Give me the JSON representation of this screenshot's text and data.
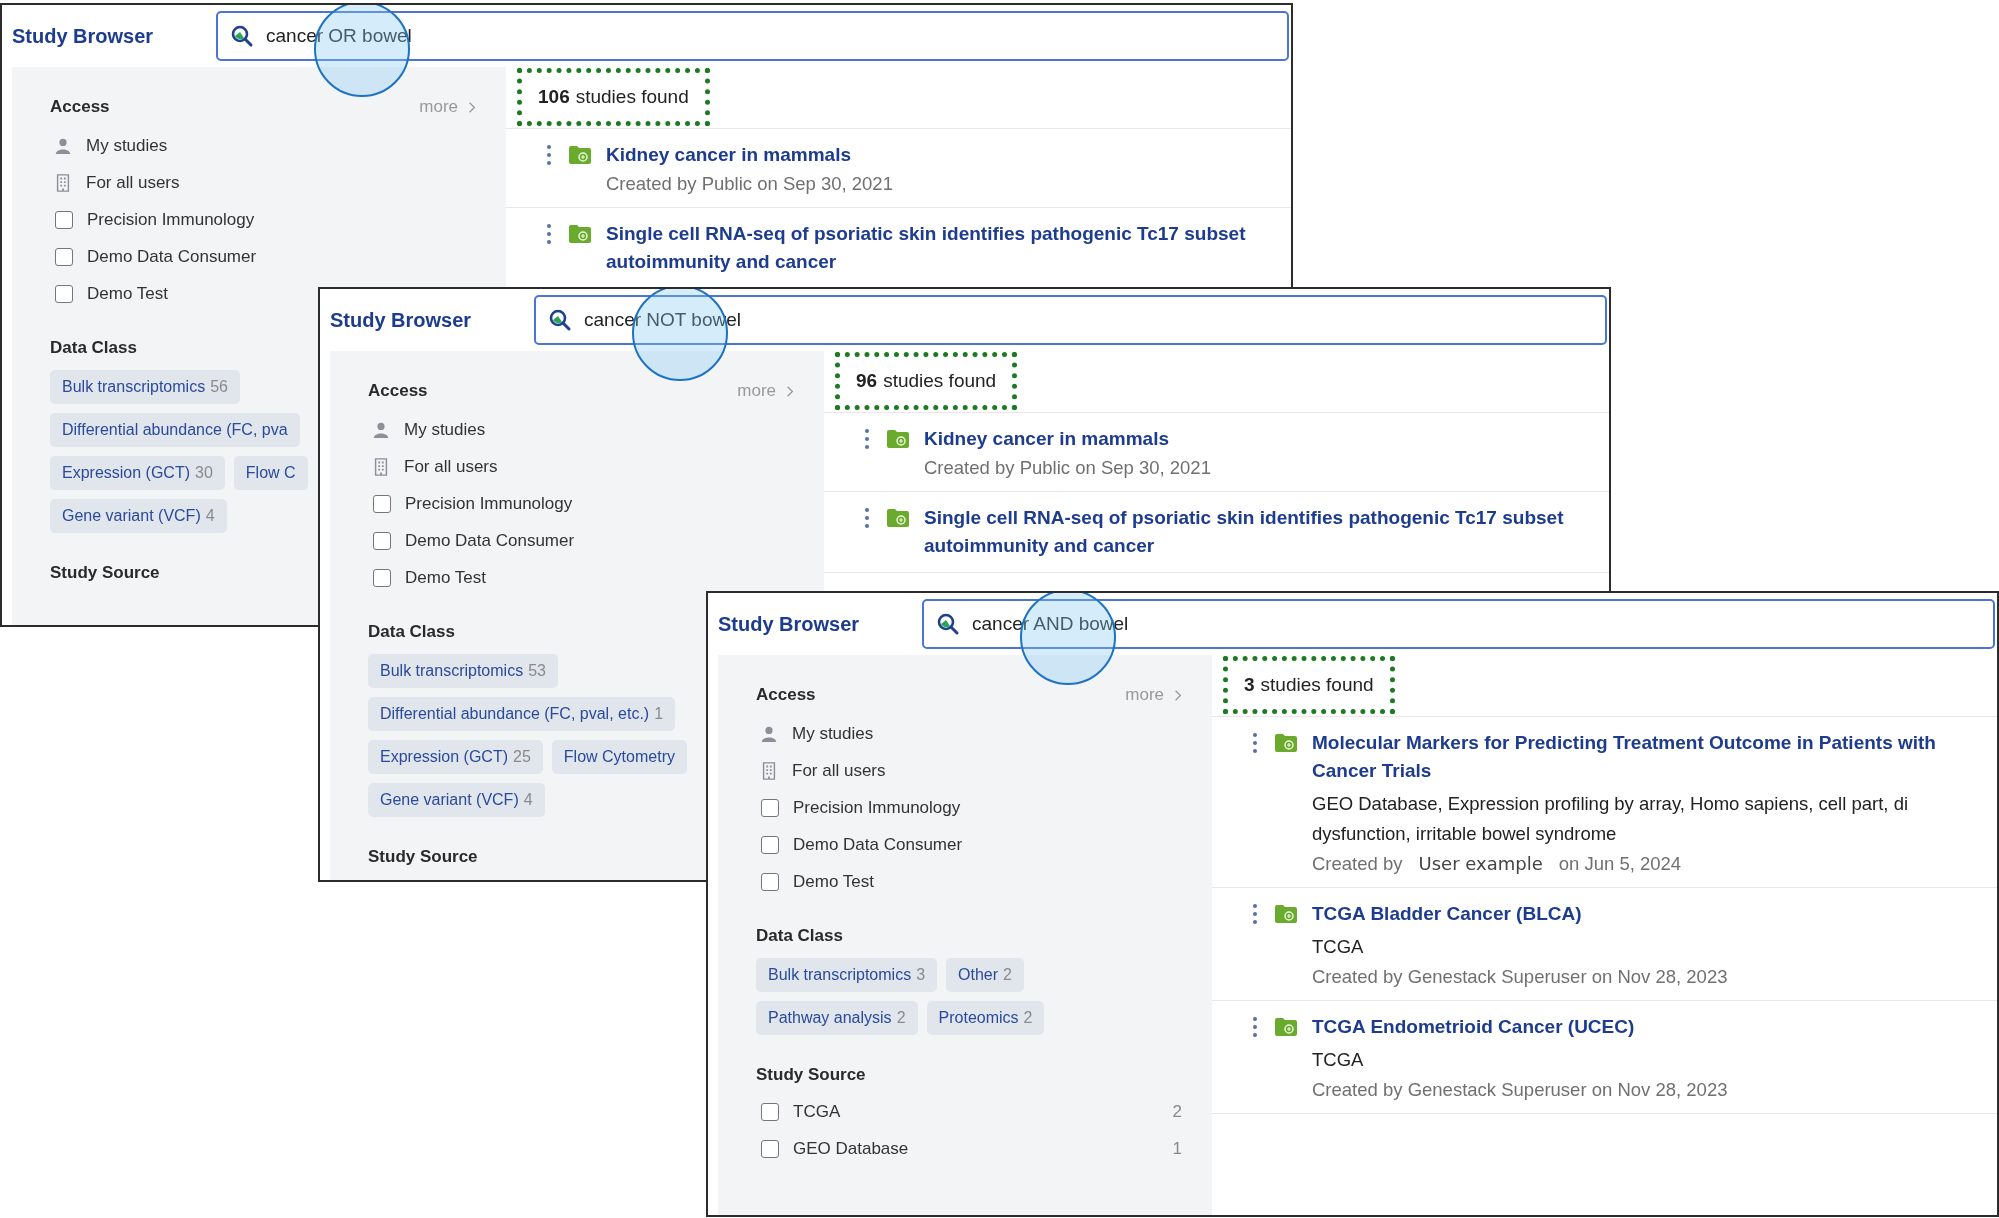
{
  "windows": [
    {
      "brand": "Study Browser",
      "search": {
        "value": "cancer OR bowel"
      },
      "sidebar": {
        "access": {
          "heading": "Access",
          "more": "more",
          "items": [
            {
              "kind": "person",
              "label": "My studies"
            },
            {
              "kind": "building",
              "label": "For all users"
            },
            {
              "kind": "checkbox",
              "label": "Precision Immunology",
              "checked": false
            },
            {
              "kind": "checkbox",
              "label": "Demo Data Consumer",
              "checked": false
            },
            {
              "kind": "checkbox",
              "label": "Demo Test",
              "checked": false
            }
          ]
        },
        "data_class": {
          "heading": "Data Class",
          "chip_rows": [
            [
              {
                "label": "Bulk transcriptomics",
                "count": "56"
              }
            ],
            [
              {
                "label": "Differential abundance (FC, pva"
              }
            ],
            [
              {
                "label": "Expression (GCT)",
                "count": "30"
              },
              {
                "label": "Flow C"
              }
            ],
            [
              {
                "label": "Gene variant (VCF)",
                "count": "4"
              }
            ]
          ]
        },
        "study_source": {
          "heading": "Study Source"
        }
      },
      "results": {
        "count": "106",
        "count_label": "studies found",
        "studies": [
          {
            "title_lines": [
              "Kidney cancer in mammals"
            ],
            "meta_parts": [
              {
                "text": "Created by Public on Sep 30, 2021",
                "kind": "plain"
              }
            ]
          },
          {
            "title_lines": [
              "Single cell RNA-seq of psoriatic skin identifies pathogenic Tc17 subset",
              "autoimmunity and cancer"
            ]
          }
        ]
      }
    },
    {
      "brand": "Study Browser",
      "search": {
        "value": "cancer NOT bowel"
      },
      "sidebar": {
        "access": {
          "heading": "Access",
          "more": "more",
          "items": [
            {
              "kind": "person",
              "label": "My studies"
            },
            {
              "kind": "building",
              "label": "For all users"
            },
            {
              "kind": "checkbox",
              "label": "Precision Immunology",
              "checked": false
            },
            {
              "kind": "checkbox",
              "label": "Demo Data Consumer",
              "checked": false
            },
            {
              "kind": "checkbox",
              "label": "Demo Test",
              "checked": false
            }
          ]
        },
        "data_class": {
          "heading": "Data Class",
          "chip_rows": [
            [
              {
                "label": "Bulk transcriptomics",
                "count": "53"
              }
            ],
            [
              {
                "label": "Differential abundance (FC, pval, etc.)",
                "count": "1"
              }
            ],
            [
              {
                "label": "Expression (GCT)",
                "count": "25"
              },
              {
                "label": "Flow Cytometry"
              }
            ],
            [
              {
                "label": "Gene variant (VCF)",
                "count": "4"
              }
            ]
          ]
        },
        "study_source": {
          "heading": "Study Source"
        }
      },
      "results": {
        "count": "96",
        "count_label": "studies found",
        "studies": [
          {
            "title_lines": [
              "Kidney cancer in mammals"
            ],
            "meta_parts": [
              {
                "text": "Created by Public on Sep 30, 2021",
                "kind": "plain"
              }
            ]
          },
          {
            "title_lines": [
              "Single cell RNA-seq of psoriatic skin identifies pathogenic Tc17 subset",
              "autoimmunity and cancer"
            ]
          }
        ]
      }
    },
    {
      "brand": "Study Browser",
      "search": {
        "value": "cancer AND bowel"
      },
      "sidebar": {
        "access": {
          "heading": "Access",
          "more": "more",
          "items": [
            {
              "kind": "person",
              "label": "My studies"
            },
            {
              "kind": "building",
              "label": "For all users"
            },
            {
              "kind": "checkbox",
              "label": "Precision Immunology",
              "checked": false
            },
            {
              "kind": "checkbox",
              "label": "Demo Data Consumer",
              "checked": false
            },
            {
              "kind": "checkbox",
              "label": "Demo Test",
              "checked": false
            }
          ]
        },
        "data_class": {
          "heading": "Data Class",
          "chip_rows": [
            [
              {
                "label": "Bulk transcriptomics",
                "count": "3"
              },
              {
                "label": "Other",
                "count": "2"
              }
            ],
            [
              {
                "label": "Pathway analysis",
                "count": "2"
              },
              {
                "label": "Proteomics",
                "count": "2"
              }
            ]
          ]
        },
        "study_source": {
          "heading": "Study Source",
          "items": [
            {
              "label": "TCGA",
              "count": "2",
              "checked": false
            },
            {
              "label": "GEO Database",
              "count": "1",
              "checked": false
            }
          ]
        }
      },
      "results": {
        "count": "3",
        "count_label": "studies found",
        "studies": [
          {
            "title_lines": [
              "Molecular Markers for Predicting Treatment Outcome in Patients with",
              "Cancer Trials"
            ],
            "subtitle_lines": [
              "GEO Database, Expression profiling by array, Homo sapiens, cell part, di",
              "dysfunction, irritable bowel syndrome"
            ],
            "meta_parts": [
              {
                "text": "Created by",
                "kind": "plain"
              },
              {
                "text": "User example",
                "kind": "pasted"
              },
              {
                "text": "on Jun 5, 2024",
                "kind": "plain"
              }
            ]
          },
          {
            "title_lines": [
              "TCGA Bladder Cancer (BLCA)"
            ],
            "subtitle_lines": [
              "TCGA"
            ],
            "meta_parts": [
              {
                "text": "Created by Genestack Superuser on Nov 28, 2023",
                "kind": "plain"
              }
            ]
          },
          {
            "title_lines": [
              "TCGA Endometrioid Cancer (UCEC)"
            ],
            "subtitle_lines": [
              "TCGA"
            ],
            "meta_parts": [
              {
                "text": "Created by Genestack Superuser on Nov 28, 2023",
                "kind": "plain"
              }
            ]
          }
        ]
      }
    }
  ]
}
